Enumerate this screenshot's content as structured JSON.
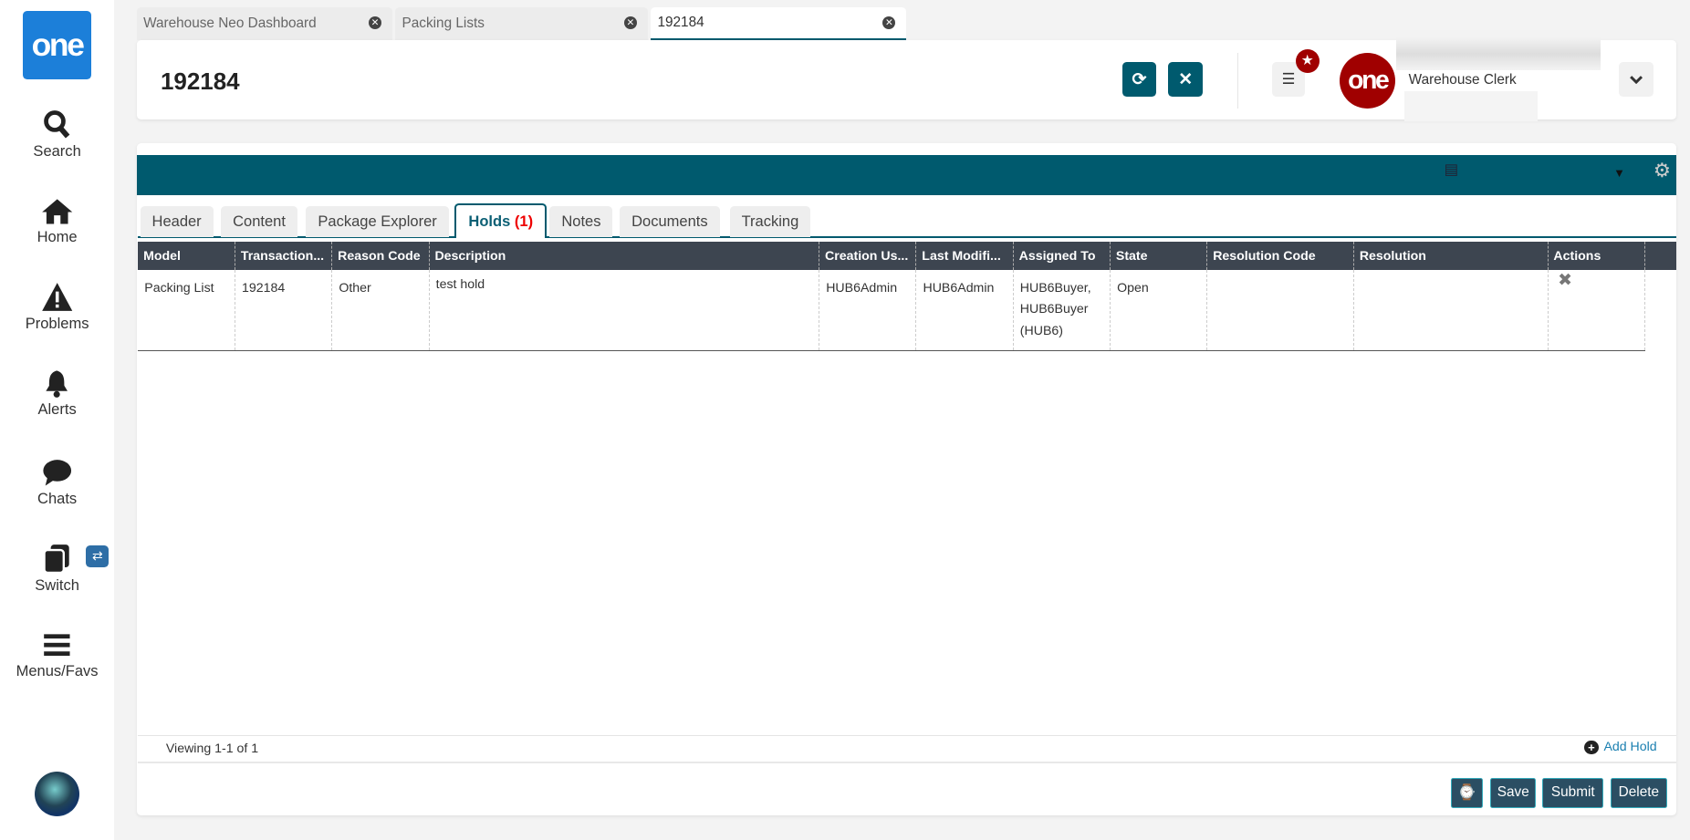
{
  "sidebar": {
    "logo": "one",
    "items": [
      {
        "label": "Search",
        "icon": "search-icon"
      },
      {
        "label": "Home",
        "icon": "home-icon"
      },
      {
        "label": "Problems",
        "icon": "warning-icon"
      },
      {
        "label": "Alerts",
        "icon": "bell-icon"
      },
      {
        "label": "Chats",
        "icon": "chat-icon"
      },
      {
        "label": "Switch",
        "icon": "switch-icon"
      },
      {
        "label": "Menus/Favs",
        "icon": "menu-icon"
      }
    ]
  },
  "window_tabs": [
    {
      "label": "Warehouse Neo Dashboard"
    },
    {
      "label": "Packing Lists"
    },
    {
      "label": "192184",
      "active": true
    }
  ],
  "header": {
    "title": "192184",
    "user_role": "Warehouse Clerk",
    "avatar_logo": "one"
  },
  "page_tabs": [
    {
      "label": "Header"
    },
    {
      "label": "Content"
    },
    {
      "label": "Package Explorer"
    },
    {
      "label": "Holds",
      "count": "(1)",
      "active": true
    },
    {
      "label": "Notes"
    },
    {
      "label": "Documents"
    },
    {
      "label": "Tracking"
    }
  ],
  "table": {
    "columns": [
      "Model",
      "Transaction...",
      "Reason Code",
      "Description",
      "Creation Us...",
      "Last Modifi...",
      "Assigned To",
      "State",
      "Resolution Code",
      "Resolution",
      "Actions"
    ],
    "rows": [
      {
        "model": "Packing List",
        "transaction": "192184",
        "reason_code": "Other",
        "description": "test hold",
        "creation_user": "HUB6Admin",
        "last_modified": "HUB6Admin",
        "assigned_to": [
          "HUB6Buyer,",
          "HUB6Buyer",
          "(HUB6)"
        ],
        "state": "Open",
        "resolution_code": "",
        "resolution": ""
      }
    ]
  },
  "footer": {
    "viewing": "Viewing 1-1 of 1",
    "add_hold": "Add Hold"
  },
  "actions": {
    "save": "Save",
    "submit": "Submit",
    "delete": "Delete"
  },
  "colors": {
    "teal": "#005a6e",
    "logo_blue": "#1c7fd9",
    "brand_red": "#a00000"
  }
}
